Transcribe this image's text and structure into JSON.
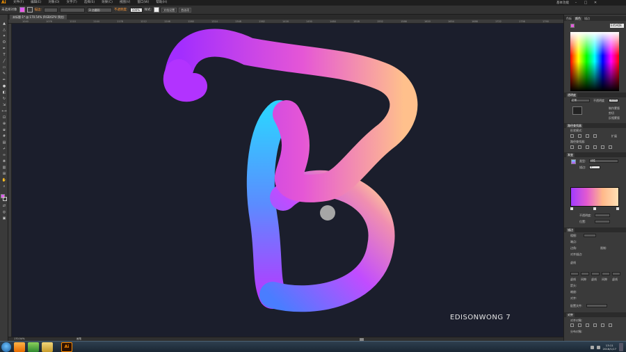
{
  "app": {
    "logo": "Ai",
    "menu": [
      "文件(F)",
      "编辑(E)",
      "对象(O)",
      "文字(T)",
      "选择(S)",
      "效果(C)",
      "视图(V)",
      "窗口(W)",
      "帮助(H)"
    ],
    "workspace": "基本功能",
    "window_controls": [
      "–",
      "□",
      "✕"
    ]
  },
  "controlbar": {
    "selection_label": "未选择对象",
    "stroke_label": "描边:",
    "brush_label": "3 点圆形",
    "opacity_label": "不透明度:",
    "opacity_value": "100%",
    "style_label": "样式:",
    "doc_setup_button": "文档设置",
    "prefs_button": "首选项"
  },
  "document_tab": {
    "title": "未标题-1* @ 170.54% (RGB/GPU 预览)"
  },
  "ruler": {
    "ticks": [
      "1040",
      "1076",
      "1110",
      "1144",
      "1178",
      "1212",
      "1246",
      "1280",
      "1314",
      "1348",
      "1382",
      "1416",
      "1450",
      "1484",
      "1518",
      "1552",
      "1586",
      "1620",
      "1654",
      "1688",
      "1722",
      "1756",
      "1790"
    ]
  },
  "canvas": {
    "background": "#1b1e2c",
    "signature": "EDISONWONG 7",
    "brush_cursor_color": "#a6a6a6"
  },
  "status": {
    "zoom": "170.54%",
    "mode": "画笔"
  },
  "panels": {
    "color_tabs": [
      "色板",
      "颜色",
      "描边"
    ],
    "hex_value": "E45ADE",
    "transparency_tab": "透明度",
    "blend_mode": "正常",
    "opacity_label": "不透明度",
    "opacity_value": "100%",
    "make_mask_button": "制作蒙版",
    "clip_label": "剪切",
    "invert_mask_label": "反相蒙版",
    "pathfinder_tab": "路径查找器",
    "shape_modes_label": "形状模式:",
    "expand_button": "扩展",
    "pathfinders_label": "路径查找器:",
    "gradient_tab": "渐变",
    "type_label": "类型:",
    "type_value": "线性",
    "angle_label": "描边:",
    "angle_value": "0°",
    "gradient_opacity_label": "不透明度:",
    "location_label": "位置:",
    "stroke_tab": "描边",
    "weight_label": "粗细:",
    "cap_label": "端点:",
    "corner_label": "边角:",
    "limit_label": "限制:",
    "align_label": "对齐描边:",
    "dashed_label": "虚线",
    "dash_cells": [
      "虚线",
      "间隙",
      "虚线",
      "间隙",
      "虚线",
      "间隙"
    ],
    "arrowheads_label": "箭头:",
    "scale_label": "缩放:",
    "align_arrow_label": "对齐:",
    "profile_label": "配置文件:",
    "align_tab": "对齐",
    "align_objects_label": "对齐对象:",
    "distribute_objects_label": "分布对象:",
    "gradient_colors": [
      "#a13bff",
      "#e35ad0",
      "#ffb98a",
      "#ffe0b5"
    ]
  },
  "taskbar": {
    "time": "13:11",
    "date": "2016/1/17",
    "ai_label": "Ai"
  }
}
